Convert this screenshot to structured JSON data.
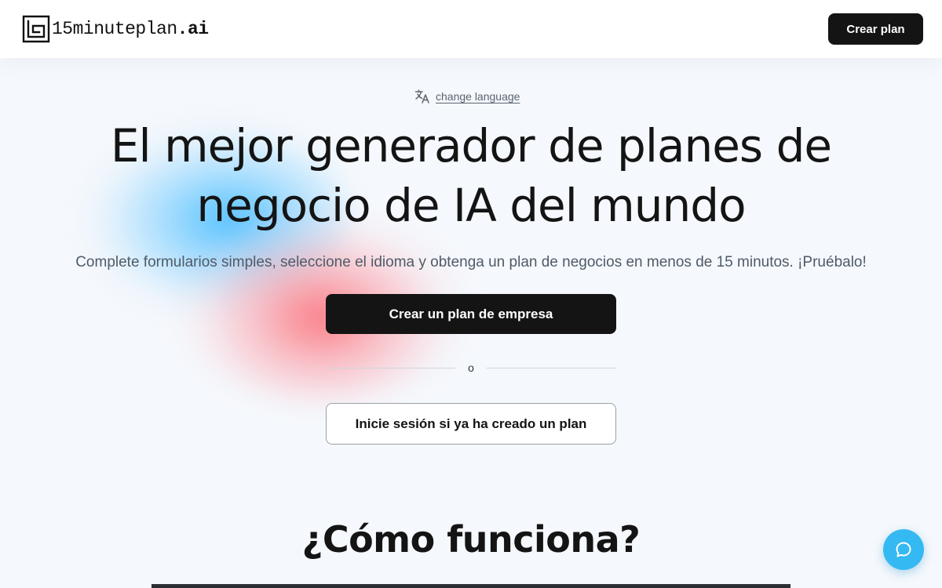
{
  "header": {
    "logo_text": "15minuteplan",
    "logo_suffix": ".ai",
    "create_plan_label": "Crear plan"
  },
  "language": {
    "icon": "translate-icon",
    "link_label": "change language"
  },
  "hero": {
    "headline_line1": "El mejor generador de planes de",
    "headline_line2": "negocio de IA del mundo",
    "subtitle": "Complete formularios simples, seleccione el idioma y obtenga un plan de negocios en menos de 15 minutos. ¡Pruébalo!",
    "primary_cta": "Crear un plan de empresa",
    "divider_text": "o",
    "secondary_cta": "Inicie sesión si ya ha creado un plan"
  },
  "how_it_works": {
    "title": "¿Cómo funciona?"
  },
  "chat": {
    "icon": "chat-bubble-icon",
    "color": "#35b9f2"
  },
  "colors": {
    "primary_button": "#141414",
    "background": "#f5f8fc",
    "blob_blue": "#4bbeff",
    "blob_red": "#fa6e78"
  }
}
